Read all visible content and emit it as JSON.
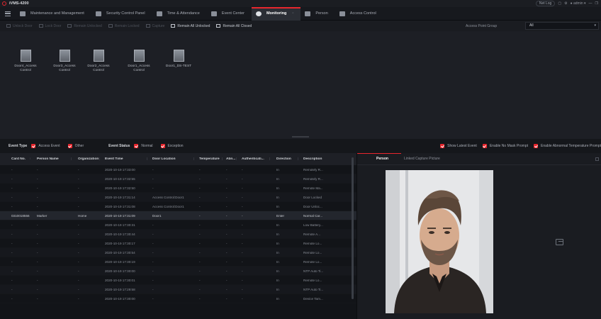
{
  "app": {
    "title": "iVMS-4200"
  },
  "titlebar_right": {
    "net_log": "Net Log",
    "user": "admin",
    "icons": [
      "lock-icon",
      "settings-icon",
      "user-icon",
      "minimize-icon",
      "restore-icon"
    ]
  },
  "tabs": [
    {
      "label": "Maintenance and Management",
      "icon": "maintenance-icon"
    },
    {
      "label": "Security Control Panel",
      "icon": "security-icon"
    },
    {
      "label": "Time & Attendance",
      "icon": "attendance-icon"
    },
    {
      "label": "Event Center",
      "icon": "event-icon"
    },
    {
      "label": "Monitoring",
      "icon": "monitoring-icon",
      "active": true
    },
    {
      "label": "Person",
      "icon": "person-icon"
    },
    {
      "label": "Access Control",
      "icon": "access-control-icon"
    }
  ],
  "toolbar": {
    "tools": [
      {
        "label": "Unlock Door",
        "enabled": false
      },
      {
        "label": "Lock Door",
        "enabled": false
      },
      {
        "label": "Remain Unlocked",
        "enabled": false
      },
      {
        "label": "Remain Locked",
        "enabled": false
      },
      {
        "label": "Capture",
        "enabled": false
      },
      {
        "label": "Remain All Unlocked",
        "enabled": true
      },
      {
        "label": "Remain All Closed",
        "enabled": true
      }
    ],
    "access_point_group_label": "Access Point Group",
    "access_point_group_value": "All"
  },
  "doors": [
    {
      "label": "Door4_Access Control"
    },
    {
      "label": "Door3_Access Control"
    },
    {
      "label": "Door2_Access Control"
    },
    {
      "label": "Door1_Access Control"
    },
    {
      "label": "Door1_DS-TEST"
    }
  ],
  "filters": {
    "event_type_label": "Event Type",
    "event_types": [
      "Access Event",
      "Other"
    ],
    "event_status_label": "Event Status",
    "event_statuses": [
      "Normal",
      "Exception"
    ],
    "right_options": [
      "Show Latest Event",
      "Enable No Mask Prompt",
      "Enable Abnormal Temperature Prompt"
    ]
  },
  "table": {
    "columns": [
      "Card No.",
      "Person Name",
      "Organization",
      "Event Time",
      "Door Location",
      "Temperature",
      "Abn...",
      "Authenticati...",
      "Direction",
      "Description"
    ],
    "rows": [
      [
        "-",
        "-",
        "-",
        "2020-10-19 17:33:00",
        "-",
        "-",
        "-",
        "-",
        "In",
        "Remotely R..."
      ],
      [
        "-",
        "-",
        "-",
        "2020-10-19 17:32:55",
        "-",
        "-",
        "-",
        "-",
        "In",
        "Remotely R..."
      ],
      [
        "-",
        "-",
        "-",
        "2020-10-19 17:32:50",
        "-",
        "-",
        "-",
        "-",
        "In",
        "Remote Ma..."
      ],
      [
        "-",
        "-",
        "-",
        "2020-10-19 17:31:14",
        "Access Control:Door1",
        "-",
        "-",
        "-",
        "In",
        "Door Locked"
      ],
      [
        "-",
        "-",
        "-",
        "2020-10-19 17:31:08",
        "Access Control:Door1",
        "-",
        "-",
        "-",
        "In",
        "Door Unloc..."
      ],
      [
        "0310018556",
        "Marker",
        "Home",
        "2020-10-19 17:31:09",
        "Door1",
        "-",
        "-",
        "-",
        "Enter",
        "Normal Car..."
      ],
      [
        "-",
        "-",
        "-",
        "2020-10-19 17:30:31",
        "-",
        "-",
        "-",
        "-",
        "In",
        "Low Battery..."
      ],
      [
        "-",
        "-",
        "-",
        "2020-10-19 17:30:44",
        "-",
        "-",
        "-",
        "-",
        "In",
        "Remote A..."
      ],
      [
        "-",
        "-",
        "-",
        "2020-10-19 17:30:17",
        "-",
        "-",
        "-",
        "-",
        "In",
        "Remote Lo..."
      ],
      [
        "-",
        "-",
        "-",
        "2020-10-19 17:30:54",
        "-",
        "-",
        "-",
        "-",
        "In",
        "Remote Lo..."
      ],
      [
        "-",
        "-",
        "-",
        "2020-10-19 17:30:19",
        "-",
        "-",
        "-",
        "-",
        "In",
        "Remote Lo..."
      ],
      [
        "-",
        "-",
        "-",
        "2020-10-19 17:30:00",
        "-",
        "-",
        "-",
        "-",
        "In",
        "NTP Auto Ti..."
      ],
      [
        "-",
        "-",
        "-",
        "2020-10-19 17:30:01",
        "-",
        "-",
        "-",
        "-",
        "In",
        "Remote Lo..."
      ],
      [
        "-",
        "-",
        "-",
        "2020-10-19 17:29:58",
        "-",
        "-",
        "-",
        "-",
        "In",
        "NTP Auto Ti..."
      ],
      [
        "-",
        "-",
        "-",
        "2020-10-19 17:30:00",
        "-",
        "-",
        "-",
        "-",
        "In",
        "Device Tam..."
      ]
    ],
    "selected_row": 5
  },
  "right_panel": {
    "tabs": [
      "Person",
      "Linked Capture Picture"
    ],
    "active_tab": 0
  },
  "colors": {
    "accent": "#e8262d",
    "background": "#111318",
    "panel": "#1d1f25"
  }
}
